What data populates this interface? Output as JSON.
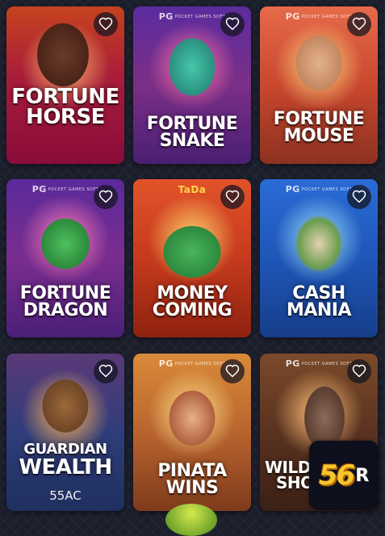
{
  "games": [
    {
      "title_lines": [
        "FORTUNE",
        "HORSE"
      ],
      "provider": "",
      "code": ""
    },
    {
      "title_lines": [
        "FORTUNE",
        "SNAKE"
      ],
      "provider": "PG",
      "provider_sub": "POCKET GAMES SOFT",
      "code": ""
    },
    {
      "title_lines": [
        "FORTUNE",
        "MOUSE"
      ],
      "provider": "PG",
      "provider_sub": "POCKET GAMES SOFT",
      "code": ""
    },
    {
      "title_lines": [
        "FORTUNE",
        "DRAGON"
      ],
      "provider": "PG",
      "provider_sub": "POCKET GAMES SOFT",
      "code": ""
    },
    {
      "title_lines": [
        "MONEY",
        "COMING"
      ],
      "provider": "TaDa",
      "code": ""
    },
    {
      "title_lines": [
        "CASH",
        "MANIA"
      ],
      "provider": "PG",
      "provider_sub": "POCKET GAMES SOFT",
      "code": ""
    },
    {
      "title_lines": [
        "GUARDIAN",
        "WEALTH"
      ],
      "provider": "",
      "code": "55AC"
    },
    {
      "title_lines": [
        "PINATA",
        "WINS"
      ],
      "provider": "PG",
      "provider_sub": "POCKET GAMES SOFT",
      "code": ""
    },
    {
      "title_lines": [
        "WILD",
        "SHOW"
      ],
      "provider": "PG",
      "provider_sub": "POCKET GAMES SOFT",
      "code": ""
    }
  ],
  "icons": {
    "favorite": "heart-outline-icon"
  },
  "logo": {
    "text": "56",
    "suffix": "R"
  },
  "colors": {
    "background": "#1b1e2b",
    "heart_bg": "#14141e",
    "logo_gold": "#f7c62d"
  }
}
